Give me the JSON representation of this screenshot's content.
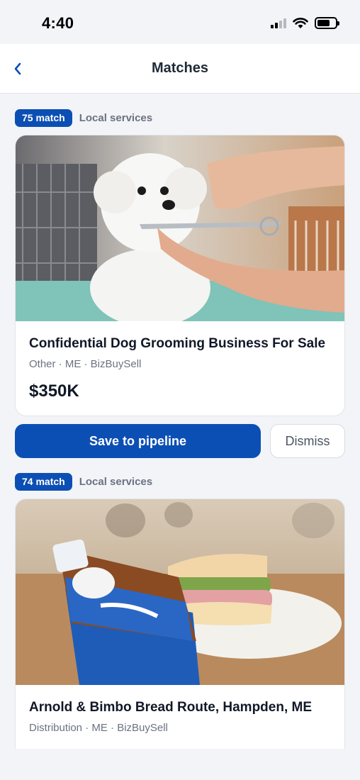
{
  "status_bar": {
    "time": "4:40"
  },
  "nav": {
    "title": "Matches",
    "back_icon": "chevron-left-icon"
  },
  "colors": {
    "accent": "#0c4fb4",
    "background": "#f2f4f8"
  },
  "listings": [
    {
      "match": "75 match",
      "category": "Local services",
      "title": "Confidential Dog Grooming Business For Sale",
      "meta": "Other · ME · BizBuySell",
      "price": "$350K",
      "image": "dog-grooming-photo"
    },
    {
      "match": "74 match",
      "category": "Local services",
      "title": "Arnold & Bimbo Bread Route, Hampden, ME",
      "meta": "Distribution · ME · BizBuySell",
      "image": "bread-and-sandwich-photo"
    }
  ],
  "actions": {
    "save_label": "Save to pipeline",
    "dismiss_label": "Dismiss"
  }
}
